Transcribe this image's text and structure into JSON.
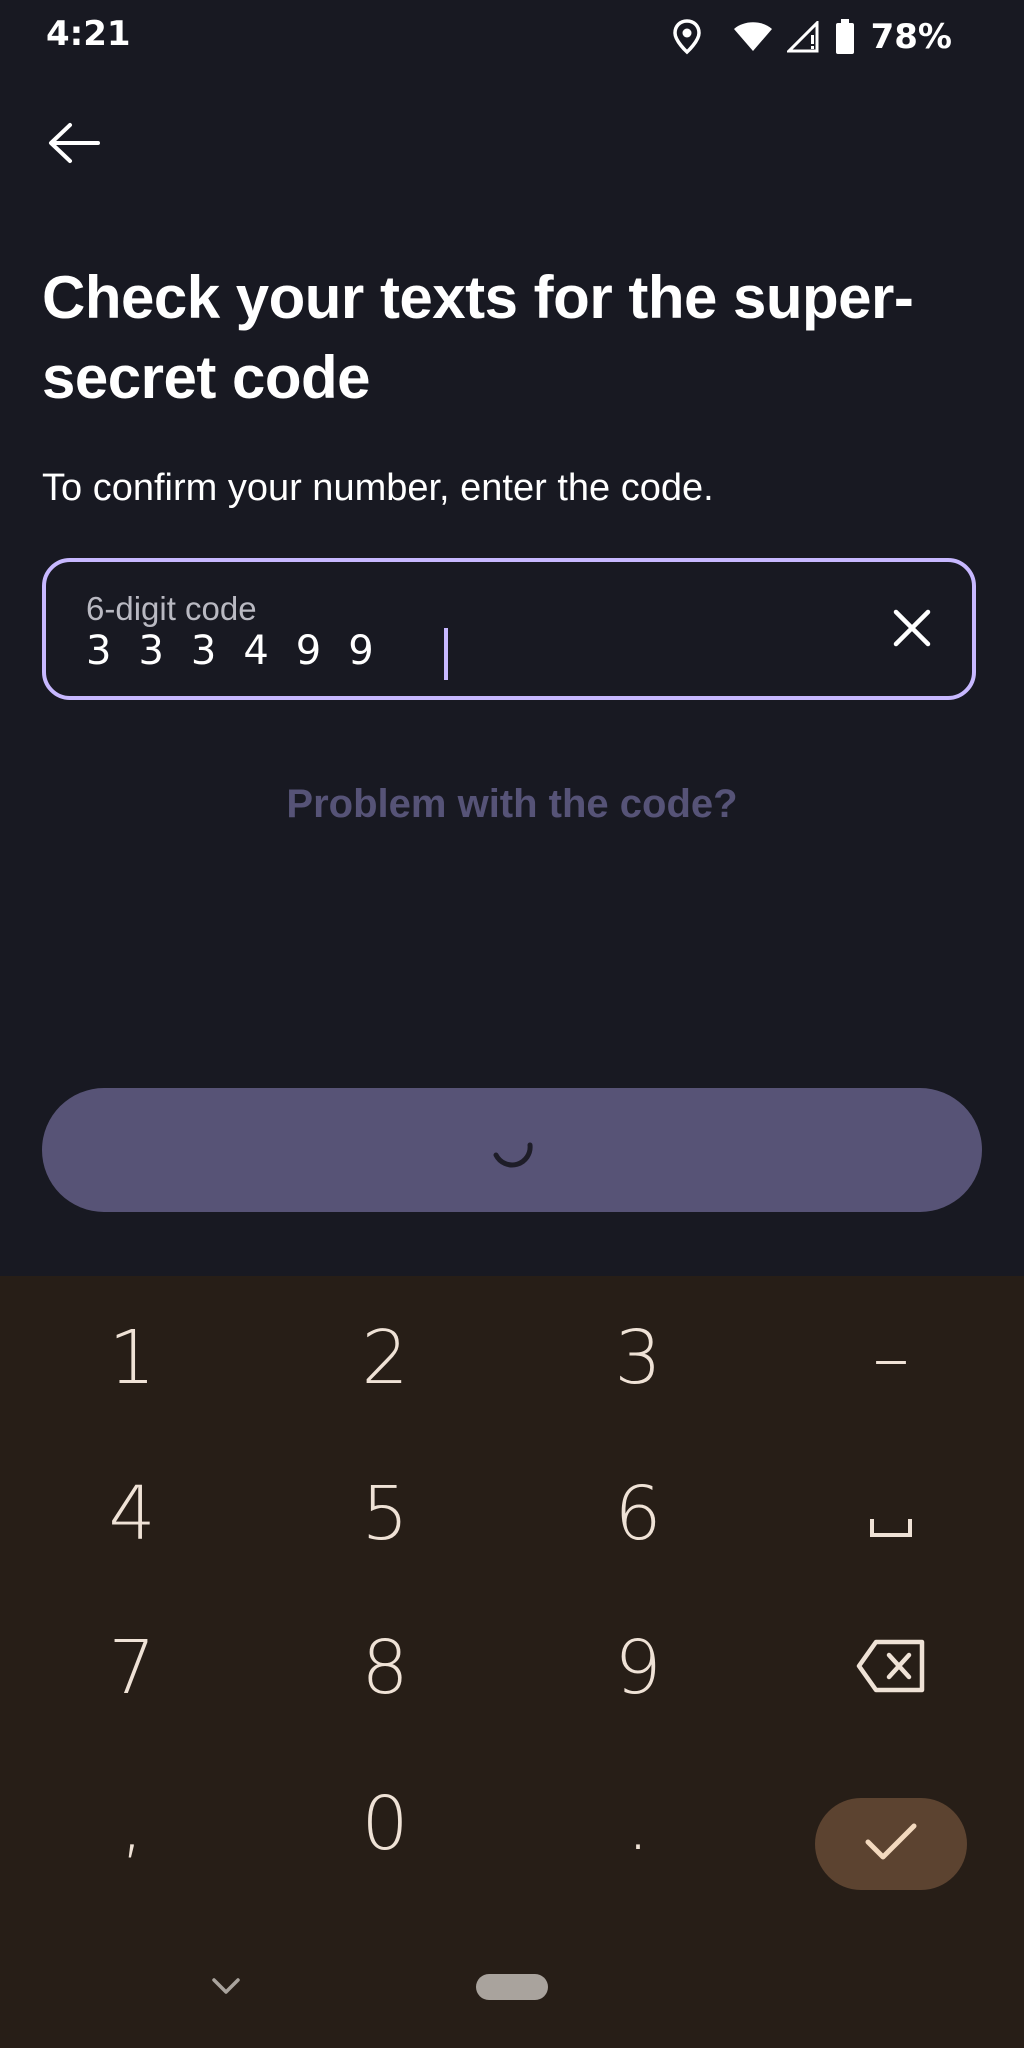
{
  "status_bar": {
    "time": "4:21",
    "battery": "78%",
    "icons": [
      "location-icon",
      "wifi-icon",
      "signal-icon",
      "battery-icon"
    ]
  },
  "header": {
    "back_icon": "arrow-left-icon"
  },
  "main": {
    "title": "Check your texts for the super-secret code",
    "subtitle": "To confirm your number, enter the code.",
    "code_field": {
      "label": "6-digit code",
      "value": "333499",
      "clear_icon": "close-icon"
    },
    "problem_link": "Problem with the code?",
    "continue_button": {
      "state": "loading",
      "icon": "spinner-icon"
    }
  },
  "keyboard": {
    "keys": [
      "1",
      "2",
      "3",
      "–",
      "4",
      "5",
      "6",
      "␣",
      "7",
      "8",
      "9",
      "⌫",
      ",",
      "0",
      ".",
      "✓"
    ],
    "backspace_icon": "backspace-icon",
    "enter_icon": "checkmark-icon",
    "hide_icon": "chevron-down-icon"
  },
  "colors": {
    "background": "#181922",
    "accent": "#c7b8ff",
    "button_bg": "#575376",
    "link": "#565377",
    "keyboard_bg": "#271e17",
    "key_text": "#efe2d6",
    "enter_key_bg": "#5c4330"
  }
}
